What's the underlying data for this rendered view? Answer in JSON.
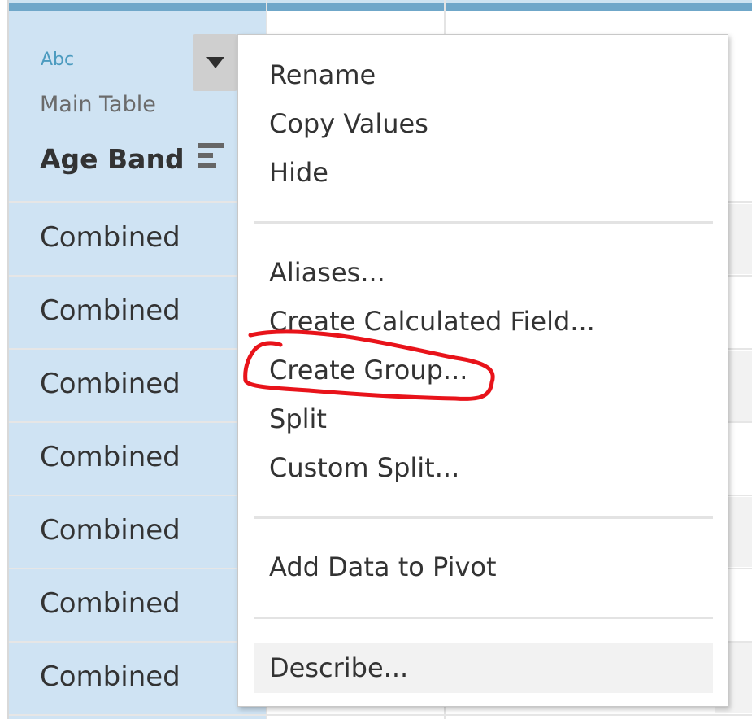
{
  "column_header": {
    "type_label": "Abc",
    "source": "Main Table",
    "field_name": "Age Band"
  },
  "rows": [
    "Combined",
    "Combined",
    "Combined",
    "Combined",
    "Combined",
    "Combined",
    "Combined"
  ],
  "context_menu": {
    "group1": [
      "Rename",
      "Copy Values",
      "Hide"
    ],
    "group2": [
      "Aliases...",
      "Create Calculated Field...",
      "Create Group...",
      "Split",
      "Custom Split..."
    ],
    "group3": [
      "Add Data to Pivot"
    ],
    "group4": [
      "Describe..."
    ]
  },
  "annotation": {
    "highlighted_item": "Create Group...",
    "color": "#e8131a"
  },
  "colors": {
    "header_bg": "#cfe3f3",
    "top_bar": "#6fa7c9",
    "type_label": "#4c9bbf"
  }
}
